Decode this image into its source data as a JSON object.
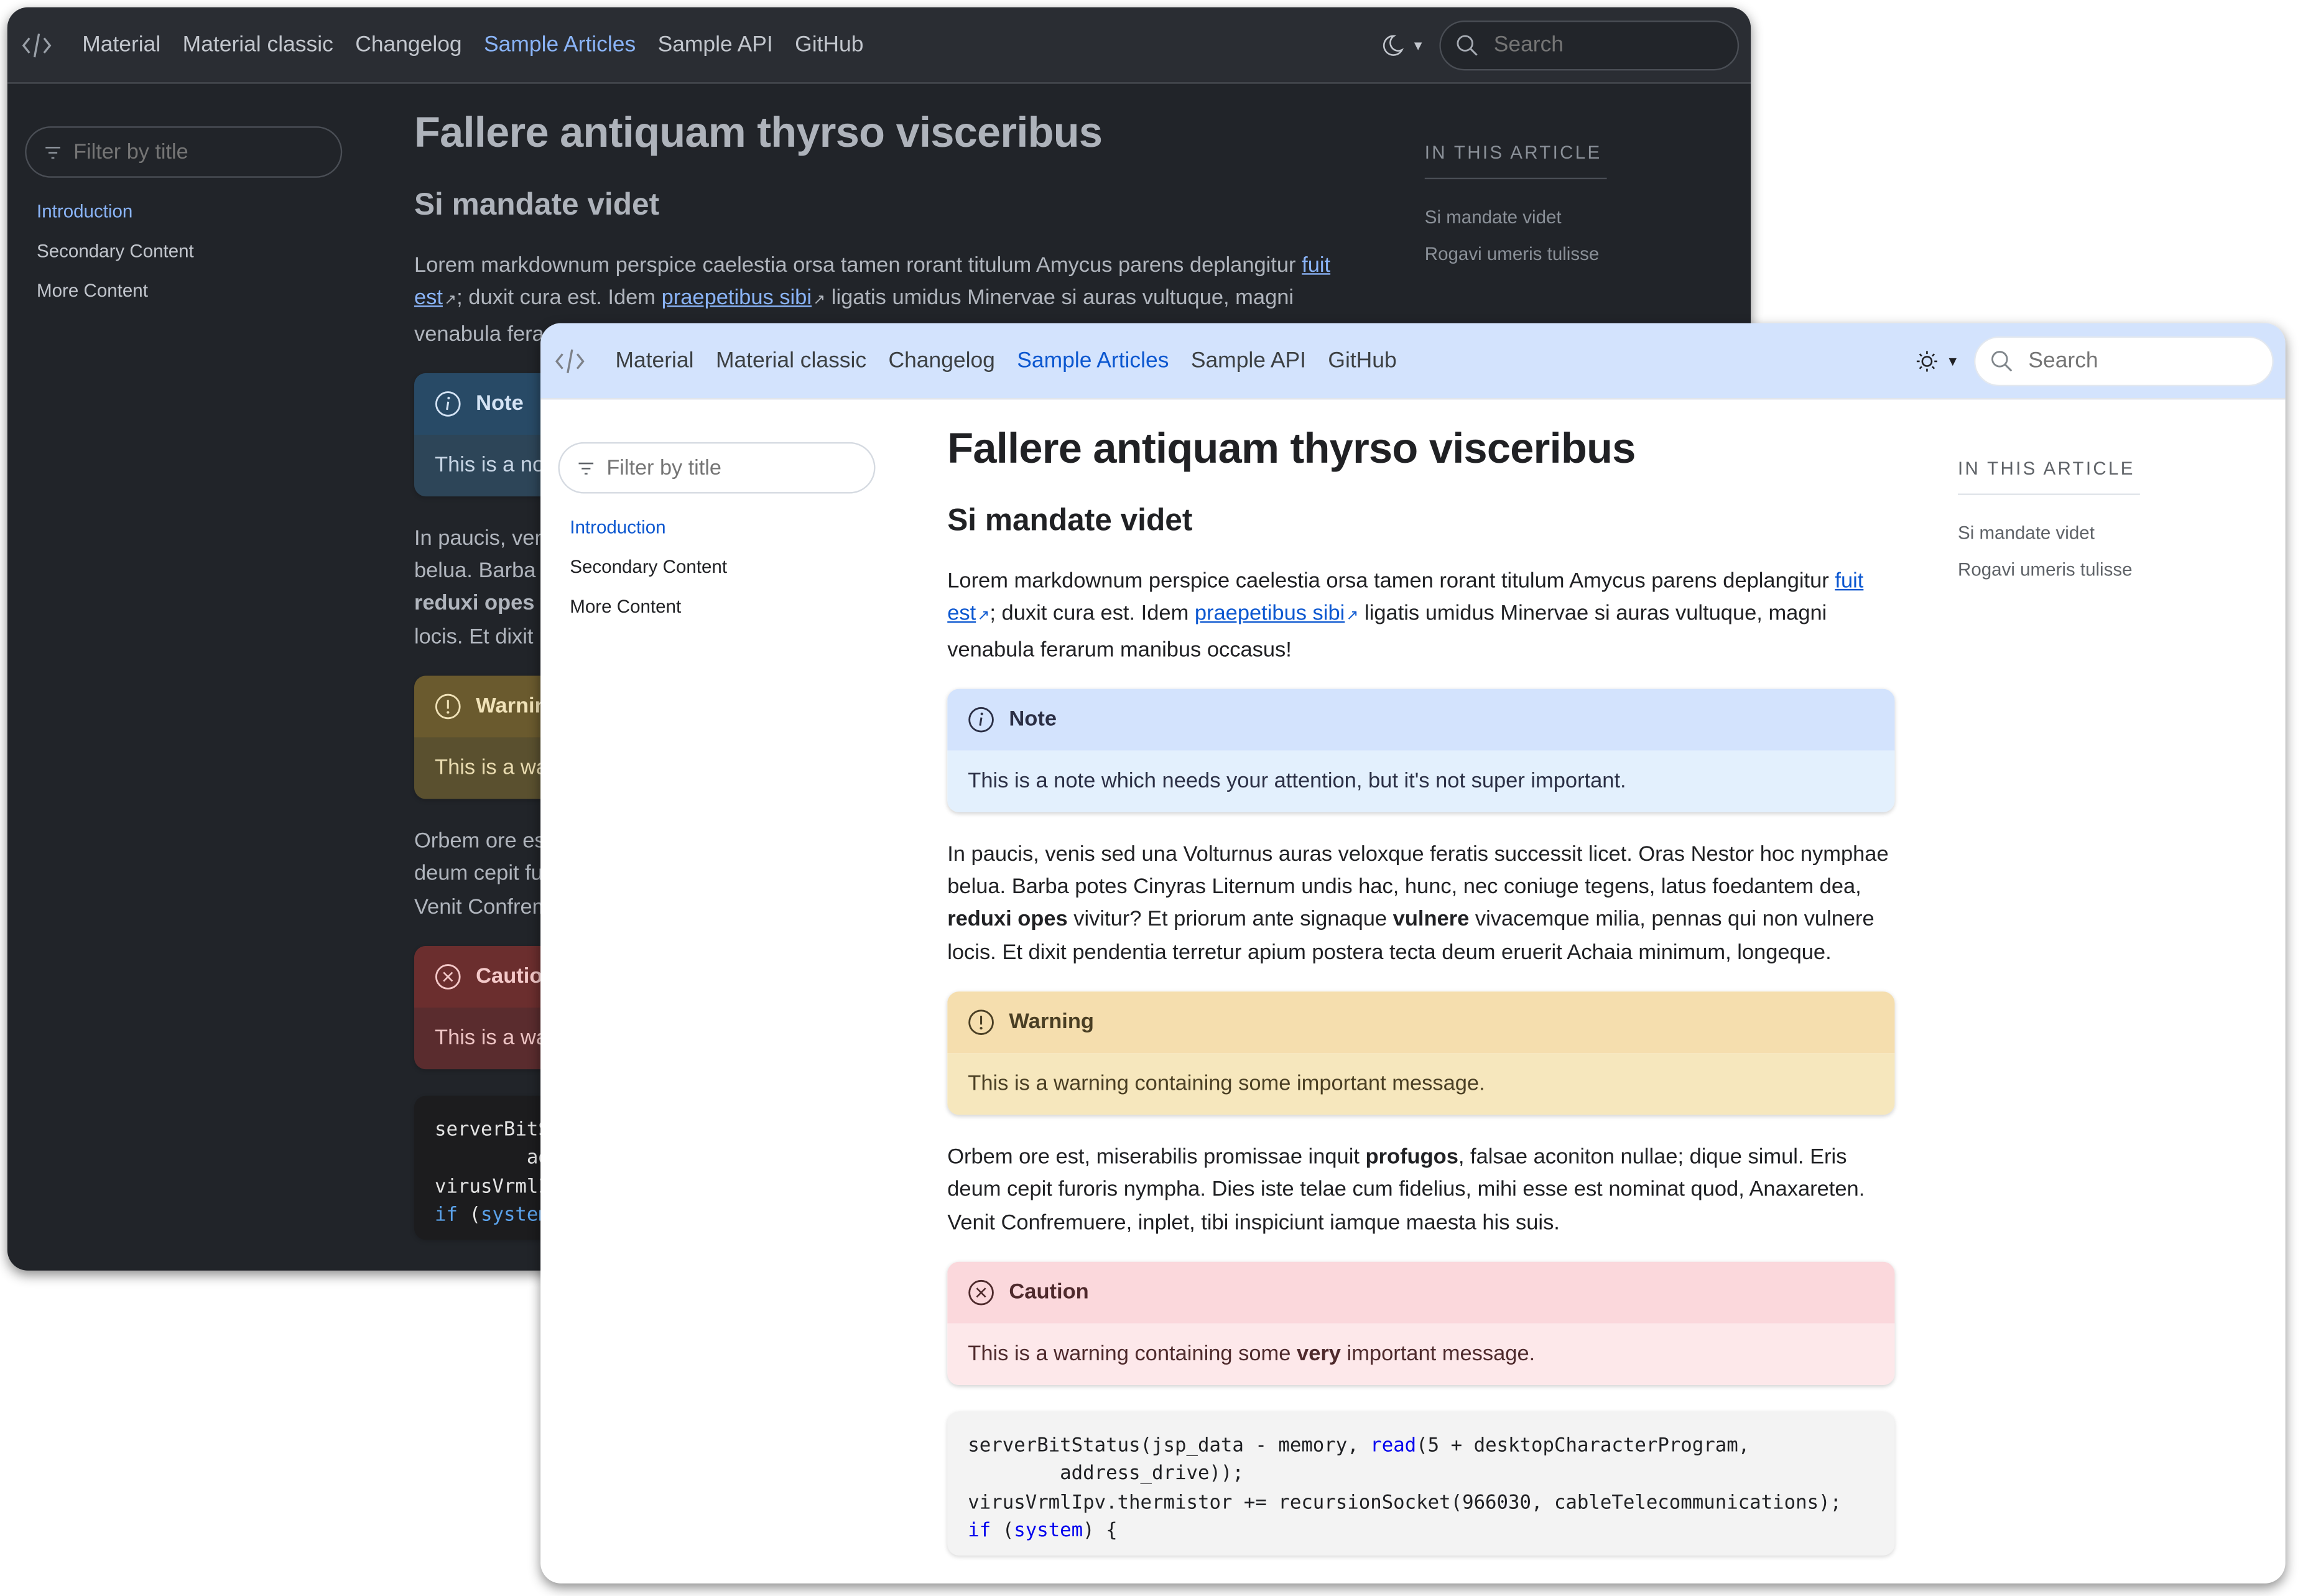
{
  "nav": {
    "items": [
      "Material",
      "Material classic",
      "Changelog",
      "Sample Articles",
      "Sample API",
      "GitHub"
    ],
    "active": "Sample Articles"
  },
  "search": {
    "placeholder": "Search"
  },
  "sidebar": {
    "filter_placeholder": "Filter by title",
    "items": [
      {
        "label": "Introduction",
        "active": true
      },
      {
        "label": "Secondary Content",
        "active": false
      },
      {
        "label": "More Content",
        "active": false
      }
    ]
  },
  "article": {
    "title": "Fallere antiquam thyrso visceribus",
    "section_heading": "Si mandate videt",
    "p1": {
      "t1": "Lorem markdownum perspice caelestia orsa tamen rorant titulum Amycus parens deplangitur ",
      "link1": "fuit est",
      "t2": "; duxit cura est. Idem ",
      "link2": "praepetibus sibi",
      "t3": " ligatis umidus Minervae si auras vultuque, magni venabula ferarum manibus occasus!"
    },
    "note": {
      "title": "Note",
      "body": "This is a note which needs your attention, but it's not super important."
    },
    "p2": {
      "t1": "In paucis, venis sed una Volturnus auras veloxque feratis successit licet. Oras Nestor hoc nymphae belua. Barba potes Cinyras Liternum undis hac, hunc, nec coniuge tegens, latus foedantem dea, ",
      "b1": "reduxi opes",
      "t2": " vivitur? Et priorum ante signaque ",
      "b2": "vulnere",
      "t3": " vivacemque milia, pennas qui non vulnere locis. Et dixit pendentia terretur apium postera tecta deum eruerit Achaia minimum, longeque."
    },
    "warning": {
      "title": "Warning",
      "body": "This is a warning containing some important message."
    },
    "p3": {
      "t1": "Orbem ore est, miserabilis promissae inquit ",
      "b1": "profugos",
      "t2": ", falsae aconiton nullae; dique simul. Eris deum cepit furoris nympha. Dies iste telae cum fidelius, mihi esse est nominat quod, Anaxareten. Venit Confremuere, inplet, tibi inspiciunt iamque maesta his suis."
    },
    "caution": {
      "title": "Caution",
      "body_pre": "This is a warning containing some ",
      "body_bold": "very",
      "body_post": " important message."
    },
    "code": {
      "l1a": "serverBitStatus(jsp_data - memory, ",
      "l1kw": "read",
      "l1b": "(5 + desktopCharacterProgram,",
      "l2": "        address_drive));",
      "l3": "virusVrmlIpv.thermistor += recursionSocket(966030, cableTelecommunications);",
      "l4kw1": "if",
      "l4a": " (",
      "l4kw2": "system",
      "l4b": ") {"
    }
  },
  "toc": {
    "title": "IN THIS ARTICLE",
    "items": [
      "Si mandate videt",
      "Rogavi umeris tulisse"
    ]
  },
  "themes": {
    "dark": {
      "icon": "moon-icon",
      "accent": "#8ab4f8",
      "background": "#212429"
    },
    "light": {
      "icon": "sun-icon",
      "accent": "#0b57d0",
      "background": "#ffffff"
    }
  }
}
